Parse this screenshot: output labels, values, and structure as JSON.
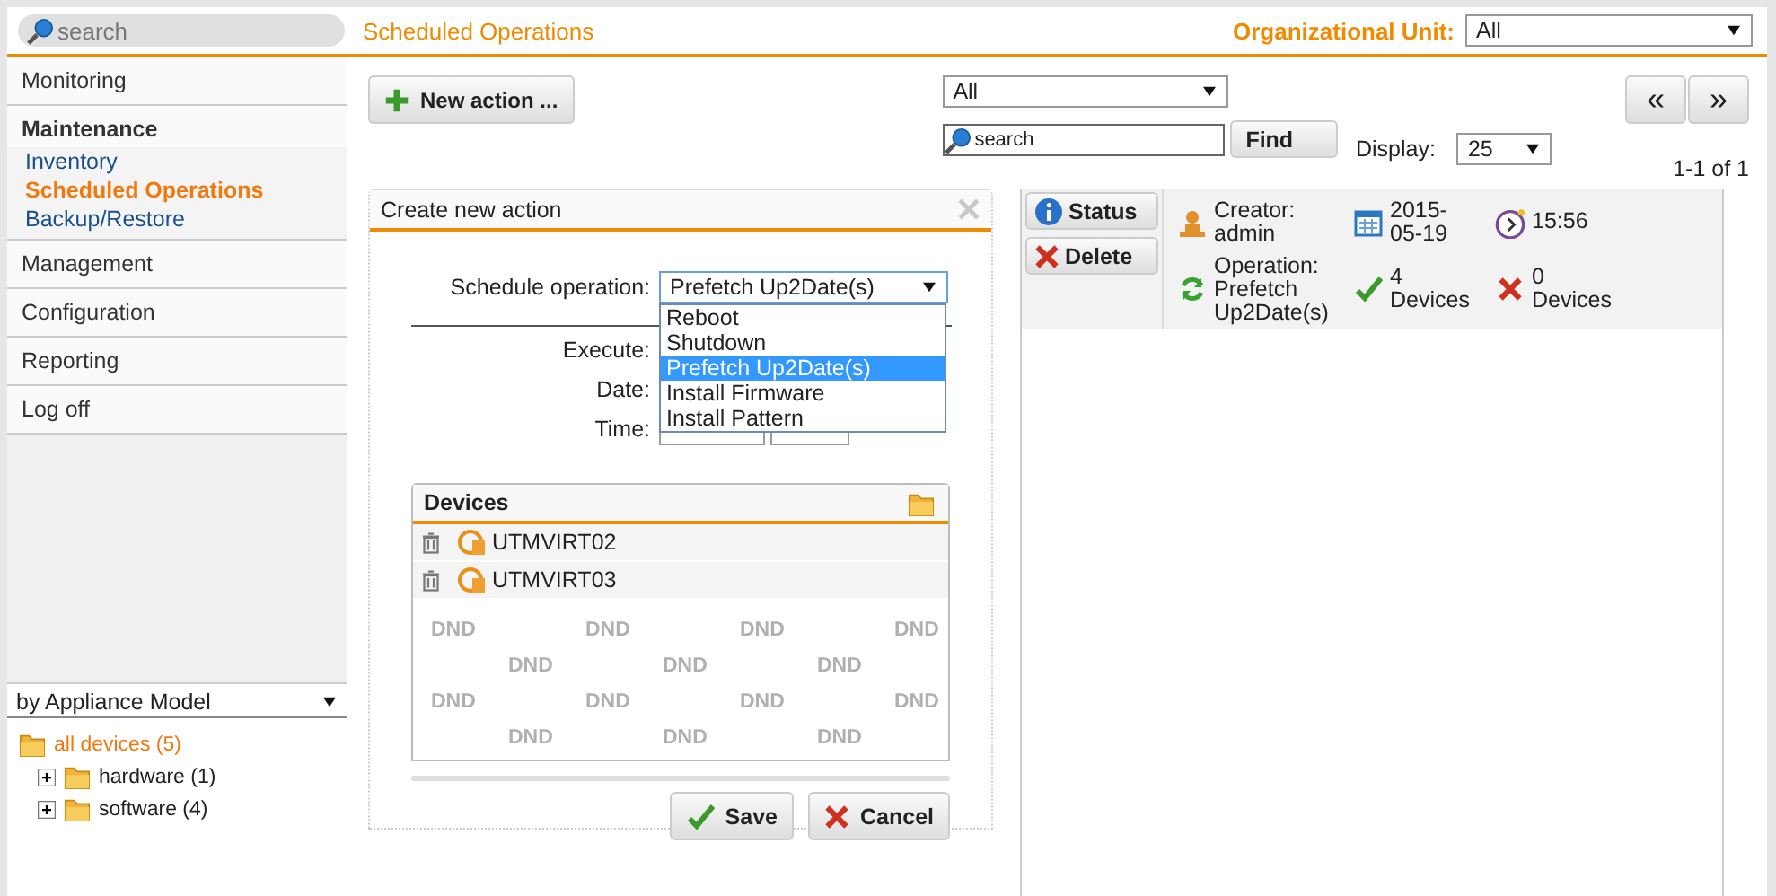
{
  "search": {
    "placeholder": "search"
  },
  "page_title": "Scheduled Operations",
  "org_unit": {
    "label": "Organizational Unit:",
    "value": "All"
  },
  "nav": [
    {
      "label": "Monitoring",
      "expanded": false
    },
    {
      "label": "Maintenance",
      "expanded": true,
      "children": [
        {
          "label": "Inventory",
          "selected": false
        },
        {
          "label": "Scheduled Operations",
          "selected": true
        },
        {
          "label": "Backup/Restore",
          "selected": false
        }
      ]
    },
    {
      "label": "Management",
      "expanded": false
    },
    {
      "label": "Configuration",
      "expanded": false
    },
    {
      "label": "Reporting",
      "expanded": false
    },
    {
      "label": "Log off",
      "expanded": false
    }
  ],
  "tree_filter": {
    "value": "by Appliance Model"
  },
  "tree": [
    {
      "label": "all devices (5)",
      "selected": true,
      "children": [
        {
          "label": "hardware (1)",
          "selected": false
        },
        {
          "label": "software (4)",
          "selected": false
        }
      ]
    }
  ],
  "toolbar": {
    "new_action": "New action ...",
    "filter": "All",
    "search_placeholder": "search",
    "find": "Find",
    "prev": "«",
    "next": "»",
    "display_label": "Display:",
    "display_value": "25",
    "range": "1-1 of 1"
  },
  "dialog": {
    "title": "Create new action",
    "schedule_label": "Schedule operation:",
    "schedule_value": "Prefetch Up2Date(s)",
    "expanded": true,
    "options": [
      {
        "label": "Reboot",
        "selected": false
      },
      {
        "label": "Shutdown",
        "selected": false
      },
      {
        "label": "Prefetch Up2Date(s)",
        "selected": true
      },
      {
        "label": "Install Firmware",
        "selected": false
      },
      {
        "label": "Install Pattern",
        "selected": false
      }
    ],
    "field_labels": [
      "Execute:",
      "Date:",
      "Time:"
    ],
    "devices": {
      "title": "Devices",
      "rows": [
        {
          "name": "UTMVIRT02"
        },
        {
          "name": "UTMVIRT03"
        }
      ],
      "drop_hint": [
        "DND",
        "DND",
        "DND",
        "DND",
        "DND",
        "DND",
        "DND",
        "DND",
        "DND",
        "DND",
        "DND",
        "DND",
        "DND",
        "DND"
      ]
    },
    "buttons": [
      {
        "label": "Save",
        "kind": "save"
      },
      {
        "label": "Cancel",
        "kind": "cancel"
      }
    ]
  },
  "operations": [
    {
      "status": "Status",
      "delete": "Delete",
      "creator": "Creator: admin",
      "date": "2015-05-19",
      "time": "15:56",
      "operation": "Operation: Prefetch Up2Date(s)",
      "succeeded": "4 Devices",
      "failed": "0 Devices"
    }
  ]
}
